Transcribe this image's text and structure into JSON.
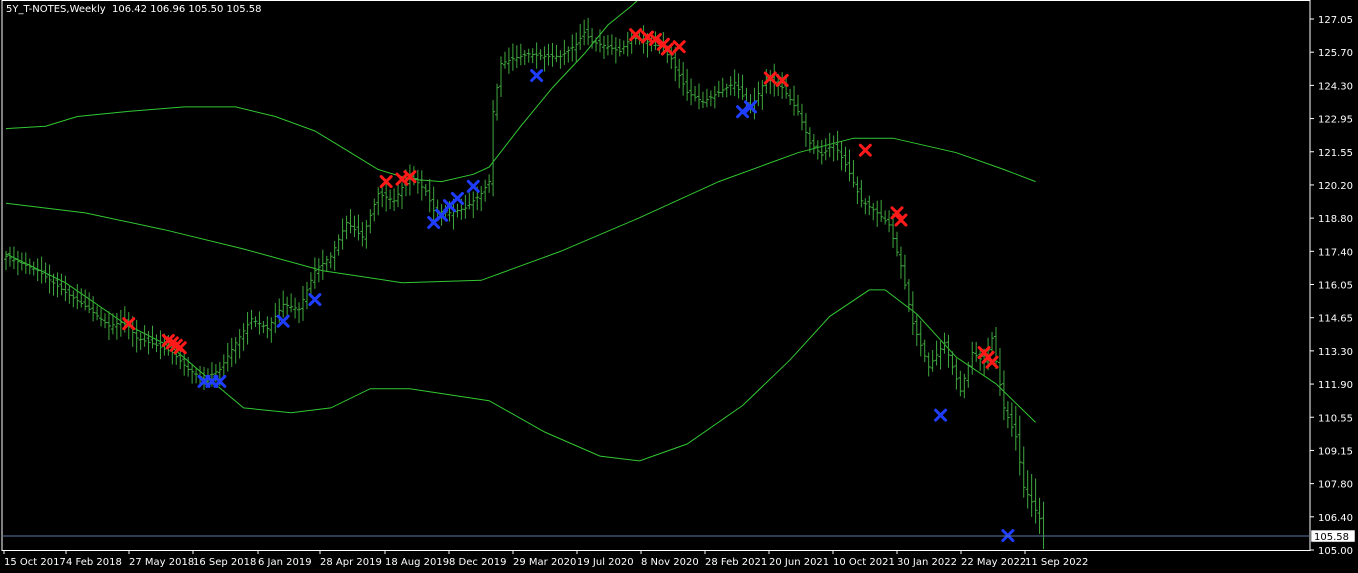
{
  "header": {
    "symbol": "5Y_T-NOTES,Weekly",
    "ohlc": "106.42 106.96 105.50 105.58"
  },
  "colors": {
    "background": "#000000",
    "axis": "#ffffff",
    "bars": "#3ea83e",
    "bands": "#32c832",
    "sell_marker": "#ff1a1a",
    "buy_marker": "#1f3dff",
    "current_price_line": "#5a78a0",
    "label_box": "#ffffff"
  },
  "chart_data": {
    "type": "ohlc",
    "timeframe": "Weekly",
    "x_tick_labels": [
      "15 Oct 2017",
      "4 Feb 2018",
      "27 May 2018",
      "16 Sep 2018",
      "6 Jan 2019",
      "28 Apr 2019",
      "18 Aug 2019",
      "8 Dec 2019",
      "29 Mar 2020",
      "19 Jul 2020",
      "8 Nov 2020",
      "28 Feb 2021",
      "20 Jun 2021",
      "10 Oct 2021",
      "30 Jan 2022",
      "22 May 2022",
      "11 Sep 2022"
    ],
    "y_tick_labels": [
      "127.05",
      "125.70",
      "124.30",
      "122.95",
      "121.55",
      "120.20",
      "118.80",
      "117.40",
      "116.05",
      "114.65",
      "113.30",
      "111.90",
      "110.55",
      "109.15",
      "107.80",
      "106.40",
      "105.00"
    ],
    "ylim": [
      105.0,
      127.05
    ],
    "current_price": 105.58,
    "current_price_label": "105.58",
    "price_path": [
      [
        0,
        117.2
      ],
      [
        8,
        116.6
      ],
      [
        15,
        115.7
      ],
      [
        21,
        115.0
      ],
      [
        26,
        114.3
      ],
      [
        30,
        114.5
      ],
      [
        33,
        113.8
      ],
      [
        38,
        113.5
      ],
      [
        42,
        113.2
      ],
      [
        46,
        112.5
      ],
      [
        50,
        112.1
      ],
      [
        54,
        112.5
      ],
      [
        58,
        113.6
      ],
      [
        62,
        114.6
      ],
      [
        66,
        114.2
      ],
      [
        70,
        115.2
      ],
      [
        74,
        115.0
      ],
      [
        78,
        116.6
      ],
      [
        82,
        117.2
      ],
      [
        86,
        118.6
      ],
      [
        90,
        118.0
      ],
      [
        94,
        119.8
      ],
      [
        98,
        119.5
      ],
      [
        102,
        120.6
      ],
      [
        106,
        119.9
      ],
      [
        108,
        119.1
      ],
      [
        112,
        119.0
      ],
      [
        116,
        119.2
      ],
      [
        120,
        119.8
      ],
      [
        122,
        120.3
      ],
      [
        123,
        123.2
      ],
      [
        125,
        125.2
      ],
      [
        128,
        125.4
      ],
      [
        132,
        125.6
      ],
      [
        136,
        125.5
      ],
      [
        140,
        125.5
      ],
      [
        144,
        126.0
      ],
      [
        146,
        126.5
      ],
      [
        148,
        126.1
      ],
      [
        152,
        125.9
      ],
      [
        155,
        125.7
      ],
      [
        158,
        126.3
      ],
      [
        162,
        126.1
      ],
      [
        165,
        125.9
      ],
      [
        168,
        125.4
      ],
      [
        172,
        124.0
      ],
      [
        176,
        123.6
      ],
      [
        180,
        124.0
      ],
      [
        184,
        124.4
      ],
      [
        188,
        123.3
      ],
      [
        192,
        124.6
      ],
      [
        196,
        124.2
      ],
      [
        200,
        123.2
      ],
      [
        203,
        121.9
      ],
      [
        206,
        121.4
      ],
      [
        209,
        121.9
      ],
      [
        212,
        121.0
      ],
      [
        216,
        119.5
      ],
      [
        220,
        119.0
      ],
      [
        223,
        118.5
      ],
      [
        226,
        116.8
      ],
      [
        229,
        114.4
      ],
      [
        233,
        112.6
      ],
      [
        237,
        113.6
      ],
      [
        241,
        111.6
      ],
      [
        244,
        113.2
      ],
      [
        247,
        112.8
      ],
      [
        249,
        113.8
      ],
      [
        252,
        110.9
      ],
      [
        255,
        109.7
      ],
      [
        257,
        107.6
      ],
      [
        259,
        107.0
      ],
      [
        261,
        106.3
      ],
      [
        262,
        105.58
      ]
    ],
    "upper_band": [
      [
        0,
        122.5
      ],
      [
        10,
        122.6
      ],
      [
        18,
        123.0
      ],
      [
        30,
        123.2
      ],
      [
        45,
        123.4
      ],
      [
        58,
        123.4
      ],
      [
        68,
        123.0
      ],
      [
        78,
        122.4
      ],
      [
        86,
        121.6
      ],
      [
        94,
        120.8
      ],
      [
        102,
        120.4
      ],
      [
        110,
        120.3
      ],
      [
        118,
        120.6
      ],
      [
        122,
        120.9
      ],
      [
        130,
        122.6
      ],
      [
        138,
        124.2
      ],
      [
        146,
        125.6
      ],
      [
        152,
        126.8
      ],
      [
        158,
        127.6
      ],
      [
        162,
        128.2
      ]
    ],
    "middle_band": [
      [
        0,
        119.4
      ],
      [
        20,
        119.0
      ],
      [
        40,
        118.3
      ],
      [
        60,
        117.5
      ],
      [
        80,
        116.6
      ],
      [
        100,
        116.1
      ],
      [
        120,
        116.2
      ],
      [
        140,
        117.4
      ],
      [
        160,
        118.8
      ],
      [
        180,
        120.3
      ],
      [
        200,
        121.5
      ],
      [
        214,
        122.1
      ],
      [
        224,
        122.1
      ],
      [
        240,
        121.5
      ],
      [
        252,
        120.8
      ],
      [
        260,
        120.3
      ]
    ],
    "lower_band": [
      [
        0,
        117.3
      ],
      [
        15,
        116.1
      ],
      [
        30,
        114.4
      ],
      [
        42,
        113.4
      ],
      [
        52,
        112.0
      ],
      [
        60,
        110.9
      ],
      [
        72,
        110.7
      ],
      [
        82,
        110.9
      ],
      [
        92,
        111.7
      ],
      [
        102,
        111.7
      ],
      [
        122,
        111.2
      ],
      [
        136,
        109.9
      ],
      [
        150,
        108.9
      ],
      [
        160,
        108.7
      ],
      [
        172,
        109.4
      ],
      [
        186,
        111.0
      ],
      [
        198,
        112.9
      ],
      [
        208,
        114.7
      ],
      [
        218,
        115.8
      ],
      [
        222,
        115.8
      ],
      [
        230,
        114.8
      ],
      [
        240,
        113.0
      ],
      [
        250,
        111.9
      ],
      [
        260,
        110.3
      ]
    ],
    "sell_markers": [
      [
        31,
        114.4
      ],
      [
        41,
        113.7
      ],
      [
        42,
        113.6
      ],
      [
        43,
        113.5
      ],
      [
        44,
        113.4
      ],
      [
        96,
        120.3
      ],
      [
        100,
        120.4
      ],
      [
        102,
        120.5
      ],
      [
        159,
        126.4
      ],
      [
        162,
        126.3
      ],
      [
        164,
        126.2
      ],
      [
        166,
        126.0
      ],
      [
        167,
        125.8
      ],
      [
        170,
        125.9
      ],
      [
        193,
        124.6
      ],
      [
        196,
        124.5
      ],
      [
        217,
        121.6
      ],
      [
        225,
        119.0
      ],
      [
        226,
        118.7
      ],
      [
        247,
        113.2
      ],
      [
        248,
        113.0
      ],
      [
        249,
        112.8
      ]
    ],
    "buy_markers": [
      [
        50,
        112.0
      ],
      [
        52,
        112.0
      ],
      [
        54,
        112.0
      ],
      [
        70,
        114.5
      ],
      [
        78,
        115.4
      ],
      [
        108,
        118.6
      ],
      [
        110,
        118.9
      ],
      [
        112,
        119.3
      ],
      [
        114,
        119.6
      ],
      [
        118,
        120.1
      ],
      [
        134,
        124.7
      ],
      [
        186,
        123.2
      ],
      [
        188,
        123.4
      ],
      [
        236,
        110.6
      ],
      [
        253,
        105.6
      ]
    ]
  }
}
